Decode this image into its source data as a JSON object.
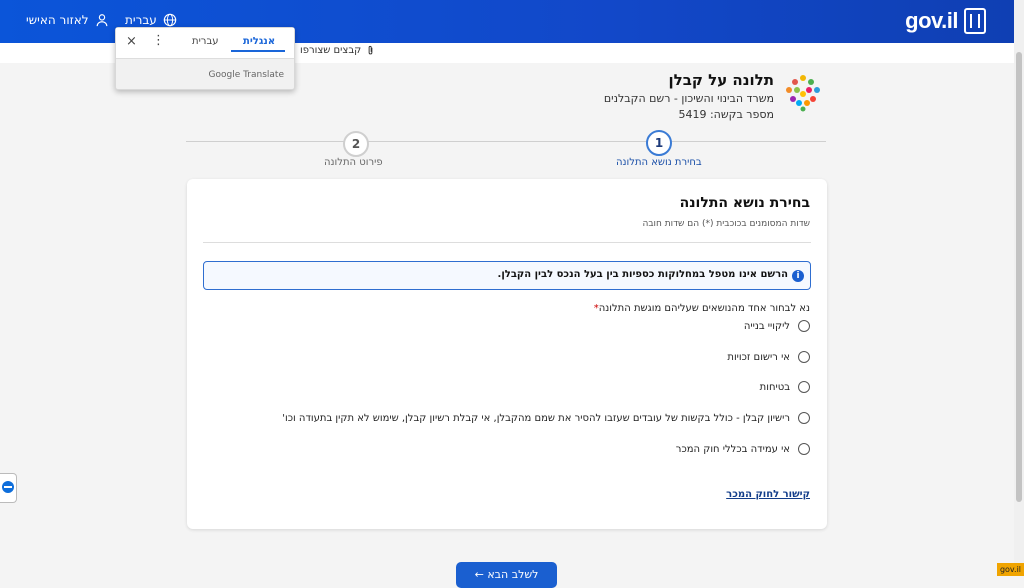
{
  "header": {
    "brand": "gov.il",
    "personal_area": "לאזור האישי",
    "language": "עברית"
  },
  "subbar": {
    "attachments": "קבצים שצורפו"
  },
  "translate_popup": {
    "tab_english": "אנגלית",
    "tab_hebrew": "עברית",
    "close": "×",
    "menu": "⋮",
    "label": "Google Translate"
  },
  "page": {
    "title": "תלונה על קבלן",
    "ministry": "משרד הבינוי והשיכון - רשם הקבלנים",
    "request_number": "מספר בקשה: 5419"
  },
  "stepper": {
    "steps": [
      {
        "number": "1",
        "label": "בחירת נושא התלונה",
        "active": true
      },
      {
        "number": "2",
        "label": "פירוט התלונה",
        "active": false
      }
    ]
  },
  "card": {
    "heading": "בחירת נושא התלונה",
    "required_note": "שדות המסומנים בכוכבית (*) הם שדות חובה",
    "info": "הרשם אינו מטפל במחלוקות כספיות בין בעל הנכס לבין הקבלן.",
    "question": "נא לבחור אחד מהנושאים שעליהם מוגשת התלונה",
    "required_star": "*",
    "options": [
      "ליקויי בנייה",
      "אי רישום זכויות",
      "בטיחות",
      "רישיון קבלן - כולל בקשות של עובדים שעזבו להסיר את שמם מהקבלן, אי קבלת רשיון קבלן, שימוש לא תקין בתעודה וכו'",
      "אי עמידה בכללי חוק המכר"
    ],
    "link": "קישור לחוק המכר"
  },
  "footer": {
    "next_button": "לשלב הבא ←",
    "badge": "gov.il"
  },
  "colors": {
    "header_blue": "#1248c9",
    "accent_blue": "#1a5fd0",
    "active_step": "#3a7bd5"
  }
}
